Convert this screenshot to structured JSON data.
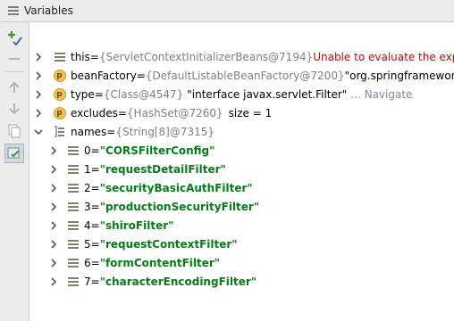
{
  "panel": {
    "title": "Variables"
  },
  "toolbar": {
    "buttons": [
      {
        "icon": "add-watch-icon"
      },
      {
        "icon": "remove-watch-icon"
      },
      {
        "icon": "move-up-icon"
      },
      {
        "icon": "move-down-icon"
      },
      {
        "icon": "copy-icon"
      },
      {
        "icon": "show-watches-icon"
      }
    ]
  },
  "variables": [
    {
      "icon": "field-icon",
      "name": "this",
      "ref": "{ServletContextInitializerBeans@7194}",
      "extra": "Unable to evaluate the expression",
      "extra_kind": "error"
    },
    {
      "icon": "protected-badge-icon",
      "badge": "p",
      "name": "beanFactory",
      "ref": "{DefaultListableBeanFactory@7200}",
      "extra": "\"org.springframework.beans.factory.support.DefaultListableBeanFactory\"",
      "extra_kind": "plain"
    },
    {
      "icon": "protected-badge-icon",
      "badge": "p",
      "name": "type",
      "ref": "{Class@4547}",
      "extra": "\"interface javax.servlet.Filter\"",
      "extra_kind": "plain",
      "link": "... Navigate"
    },
    {
      "icon": "protected-badge-icon",
      "badge": "p",
      "name": "excludes",
      "ref": "{HashSet@7260}",
      "extra": "size = 1",
      "extra_kind": "plain"
    },
    {
      "icon": "array-icon",
      "name": "names",
      "ref": "{String[8]@7315}",
      "expanded": true,
      "children": [
        {
          "index": "0",
          "value": "\"CORSFilterConfig\""
        },
        {
          "index": "1",
          "value": "\"requestDetailFilter\""
        },
        {
          "index": "2",
          "value": "\"securityBasicAuthFilter\""
        },
        {
          "index": "3",
          "value": "\"productionSecurityFilter\""
        },
        {
          "index": "4",
          "value": "\"shiroFilter\""
        },
        {
          "index": "5",
          "value": "\"requestContextFilter\""
        },
        {
          "index": "6",
          "value": "\"formContentFilter\""
        },
        {
          "index": "7",
          "value": "\"characterEncodingFilter\""
        }
      ]
    }
  ],
  "labels": {
    "equals": " = "
  },
  "colors": {
    "field_name": "#872b74",
    "ref": "#808080",
    "error": "#d60000",
    "string": "#067d17",
    "link": "#7a8aa8"
  }
}
